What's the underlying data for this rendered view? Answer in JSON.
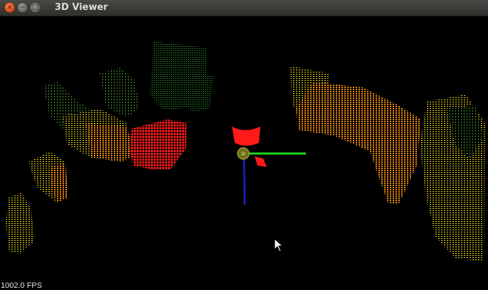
{
  "window": {
    "title": "3D Viewer",
    "controls": {
      "close": "×",
      "minimize": "−",
      "maximize": "□"
    }
  },
  "viewer": {
    "fps_label": "1002.0 FPS",
    "background": "#000000",
    "point_colors": [
      "#ff1a1a",
      "#ff8c00",
      "#ffd000",
      "#f0f000",
      "#1e7a1e",
      "#3fa13f"
    ],
    "axis_colors": {
      "x": "#1fd41f",
      "y": "#1d1dc8",
      "origin": "#8a8a2a"
    }
  }
}
